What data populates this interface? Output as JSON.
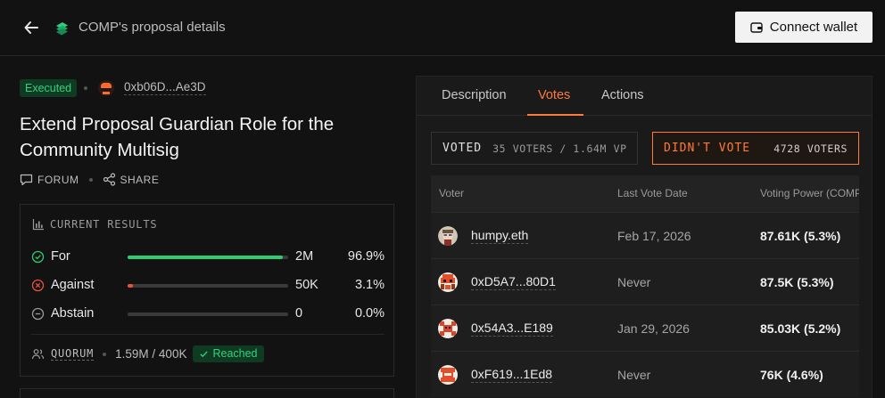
{
  "header": {
    "title": "COMP's proposal details",
    "connect_label": "Connect wallet"
  },
  "proposal": {
    "status": "Executed",
    "proposer": "0xb06D...Ae3D",
    "title": "Extend Proposal Guardian Role for the Community Multisig",
    "forum_label": "FORUM",
    "share_label": "SHARE"
  },
  "results": {
    "heading": "CURRENT RESULTS",
    "rows": [
      {
        "label": "For",
        "amount": "2M",
        "percent": "96.9%",
        "fraction": 0.969,
        "color": "#2ecc71"
      },
      {
        "label": "Against",
        "amount": "50K",
        "percent": "3.1%",
        "fraction": 0.031,
        "color": "#e8533a"
      },
      {
        "label": "Abstain",
        "amount": "0",
        "percent": "0.0%",
        "fraction": 0.0,
        "color": "#888888"
      }
    ],
    "quorum_label": "QUORUM",
    "quorum_value": "1.59M / 400K",
    "quorum_status": "Reached"
  },
  "tabs": [
    {
      "label": "Description",
      "active": false
    },
    {
      "label": "Votes",
      "active": true
    },
    {
      "label": "Actions",
      "active": false
    }
  ],
  "voted_toggle": {
    "label": "VOTED",
    "detail": "35 VOTERS / 1.64M VP"
  },
  "didnt_toggle": {
    "label": "DIDN'T VOTE",
    "detail": "4728 VOTERS"
  },
  "table": {
    "headers": [
      "Voter",
      "Last Vote Date",
      "Voting Power (COMP)"
    ],
    "rows": [
      {
        "voter": "humpy.eth",
        "date": "Feb 17, 2026",
        "power": "87.61K (5.3%)"
      },
      {
        "voter": "0xD5A7...80D1",
        "date": "Never",
        "power": "87.5K (5.3%)"
      },
      {
        "voter": "0x54A3...E189",
        "date": "Jan 29, 2026",
        "power": "85.03K (5.2%)"
      },
      {
        "voter": "0xF619...1Ed8",
        "date": "Never",
        "power": "76K (4.6%)"
      }
    ]
  },
  "colors": {
    "accent": "#ff7a3d",
    "success": "#35d07f",
    "danger": "#e8533a"
  }
}
